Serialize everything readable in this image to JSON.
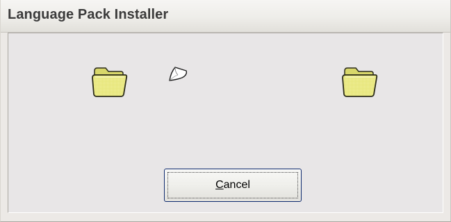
{
  "window": {
    "title": "Language Pack Installer"
  },
  "animation": {
    "source_folder_icon": "folder-icon",
    "flying_page_icon": "paper-icon",
    "destination_folder_icon": "folder-icon"
  },
  "buttons": {
    "cancel": {
      "mnemonic": "C",
      "rest": "ancel"
    }
  },
  "colors": {
    "window_bg": "#ece9e6",
    "client_bg": "#e8e6e7",
    "folder_fill": "#e6e67a",
    "button_border": "#0e2a6e"
  }
}
